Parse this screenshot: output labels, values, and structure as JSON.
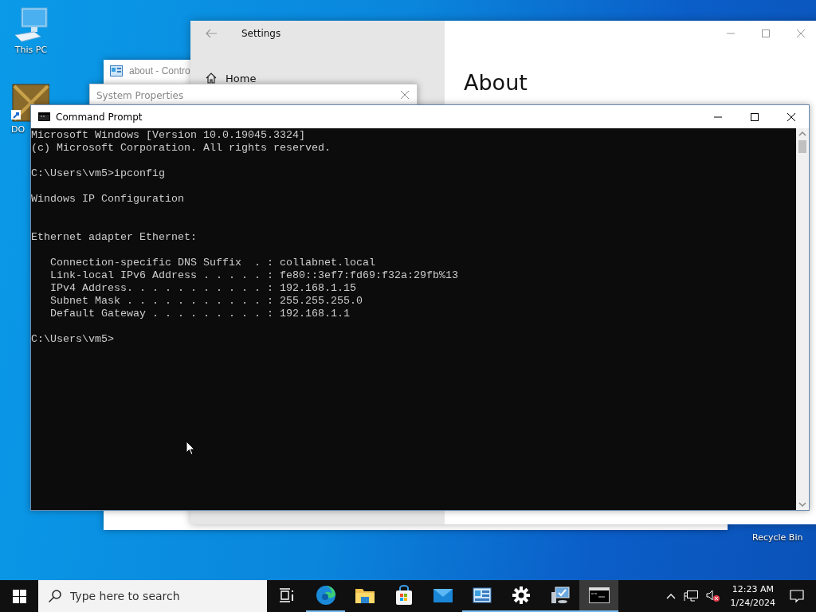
{
  "desktop_icons": [
    {
      "label": "This PC",
      "kind": "computer"
    },
    {
      "label": "DO",
      "kind": "dosbox"
    }
  ],
  "recycle_bin": {
    "label": "Recycle Bin"
  },
  "settings_window": {
    "title": "Settings",
    "nav": [
      {
        "label": "Home"
      }
    ],
    "heading": "About"
  },
  "control_panel_window": {
    "title": "about - Contro"
  },
  "system_properties_window": {
    "title": "System Properties"
  },
  "command_prompt": {
    "title": "Command Prompt",
    "lines": [
      {
        "kind": "text",
        "text": "Microsoft Windows [Version 10.0.19045.3324]"
      },
      {
        "kind": "text",
        "text": "(c) Microsoft Corporation. All rights reserved."
      },
      {
        "kind": "blank"
      },
      {
        "kind": "text",
        "text": "C:\\Users\\vm5>ipconfig"
      },
      {
        "kind": "blank"
      },
      {
        "kind": "text",
        "text": "Windows IP Configuration"
      },
      {
        "kind": "blank"
      },
      {
        "kind": "blank"
      },
      {
        "kind": "text",
        "text": "Ethernet adapter Ethernet:"
      },
      {
        "kind": "blank"
      },
      {
        "kind": "text",
        "text": "   Connection-specific DNS Suffix  . : collabnet.local"
      },
      {
        "kind": "text",
        "text": "   Link-local IPv6 Address . . . . . : fe80::3ef7:fd69:f32a:29fb%13"
      },
      {
        "kind": "text",
        "text": "   IPv4 Address. . . . . . . . . . . : 192.168.1.15"
      },
      {
        "kind": "text",
        "text": "   Subnet Mask . . . . . . . . . . . : 255.255.255.0"
      },
      {
        "kind": "text",
        "text": "   Default Gateway . . . . . . . . . : 192.168.1.1"
      },
      {
        "kind": "blank"
      },
      {
        "kind": "text",
        "text": "C:\\Users\\vm5>"
      }
    ]
  },
  "taskbar": {
    "search": {
      "placeholder": "Type here to search"
    },
    "apps": [
      {
        "kind": "taskview",
        "running": false,
        "selected": false
      },
      {
        "kind": "edge",
        "running": true,
        "selected": false
      },
      {
        "kind": "explorer",
        "running": false,
        "selected": false
      },
      {
        "kind": "store",
        "running": false,
        "selected": false
      },
      {
        "kind": "mail",
        "running": false,
        "selected": false
      },
      {
        "kind": "controlpanel",
        "running": true,
        "selected": false
      },
      {
        "kind": "settings",
        "running": true,
        "selected": false
      },
      {
        "kind": "sysprops",
        "running": true,
        "selected": false
      },
      {
        "kind": "cmd",
        "running": true,
        "selected": true
      }
    ],
    "clock": {
      "time": "12:23 AM",
      "date": "1/24/2024"
    }
  }
}
